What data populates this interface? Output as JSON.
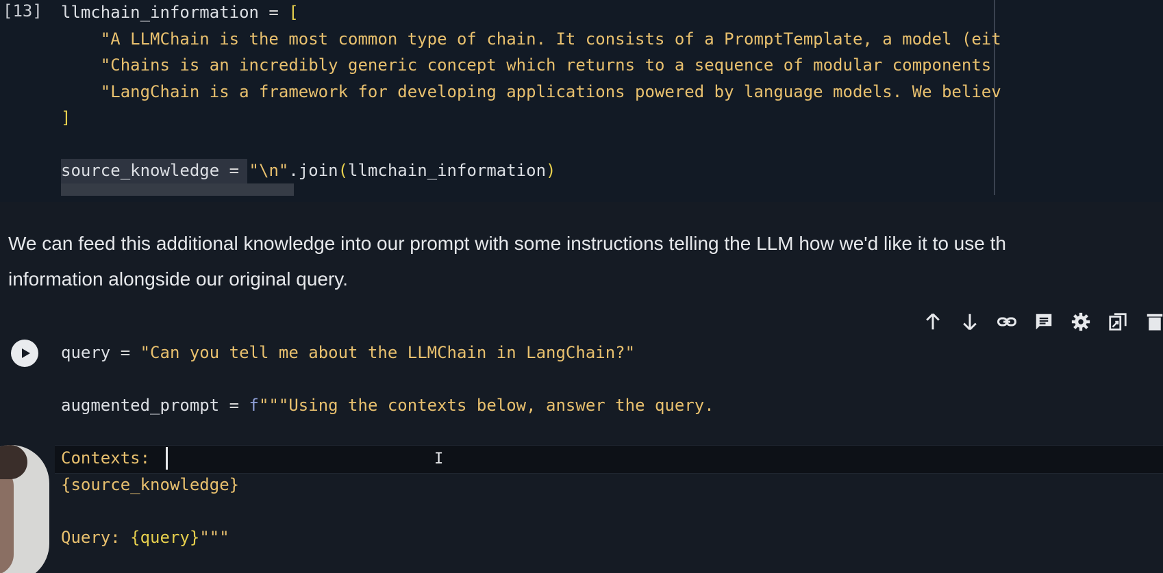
{
  "cell_top": {
    "exec_count": "[13]",
    "lines": [
      {
        "parts": [
          {
            "t": "llmchain_information",
            "c": "c-default"
          },
          {
            "t": " = ",
            "c": "c-op"
          },
          {
            "t": "[",
            "c": "c-bracket"
          }
        ]
      },
      {
        "parts": [
          {
            "t": "    \"A LLMChain is the most common type of chain. It consists of a PromptTemplate, a model (eit",
            "c": "c-string"
          }
        ]
      },
      {
        "parts": [
          {
            "t": "    \"Chains is an incredibly generic concept which returns to a sequence of modular components",
            "c": "c-string"
          }
        ]
      },
      {
        "parts": [
          {
            "t": "    \"LangChain is a framework for developing applications powered by language models. We believ",
            "c": "c-string"
          }
        ]
      },
      {
        "parts": [
          {
            "t": "]",
            "c": "c-bracket"
          }
        ]
      },
      {
        "parts": []
      },
      {
        "parts": [
          {
            "t": "source_knowledge",
            "c": "c-default"
          },
          {
            "t": " = ",
            "c": "c-op"
          },
          {
            "t": "\"\\n\"",
            "c": "c-string"
          },
          {
            "t": ".join",
            "c": "c-default"
          },
          {
            "t": "(",
            "c": "c-bracket"
          },
          {
            "t": "llmchain_information",
            "c": "c-default"
          },
          {
            "t": ")",
            "c": "c-bracket"
          }
        ]
      }
    ]
  },
  "markdown": {
    "line1": "We can feed this additional knowledge into our prompt with some instructions telling the LLM how we'd like it to use th",
    "line2": "information alongside our original query."
  },
  "toolbar": {
    "icons": [
      "arrow-up-icon",
      "arrow-down-icon",
      "link-icon",
      "comment-icon",
      "gear-icon",
      "mirror-cell-icon",
      "delete-icon"
    ]
  },
  "cell_bottom": {
    "lines": [
      {
        "parts": [
          {
            "t": "query",
            "c": "c-default"
          },
          {
            "t": " = ",
            "c": "c-op"
          },
          {
            "t": "\"Can you tell me about the LLMChain in LangChain?\"",
            "c": "c-string"
          }
        ]
      },
      {
        "parts": []
      },
      {
        "parts": [
          {
            "t": "augmented_prompt",
            "c": "c-default"
          },
          {
            "t": " = ",
            "c": "c-op"
          },
          {
            "t": "f",
            "c": "c-fprefix"
          },
          {
            "t": "\"\"\"Using the contexts below, answer the query.",
            "c": "c-string"
          }
        ]
      },
      {
        "parts": []
      },
      {
        "parts": [
          {
            "t": "Contexts:",
            "c": "c-string"
          }
        ]
      },
      {
        "parts": [
          {
            "t": "{source_knowledge}",
            "c": "c-string"
          }
        ]
      },
      {
        "parts": []
      },
      {
        "parts": [
          {
            "t": "Query: ",
            "c": "c-string"
          },
          {
            "t": "{query}",
            "c": "c-bracket"
          },
          {
            "t": "\"\"\"",
            "c": "c-string"
          }
        ]
      }
    ]
  },
  "colors": {
    "background": "#151b24",
    "string": "#e8c06e",
    "bracket": "#e6cf4d",
    "default": "#dcdfe4"
  }
}
